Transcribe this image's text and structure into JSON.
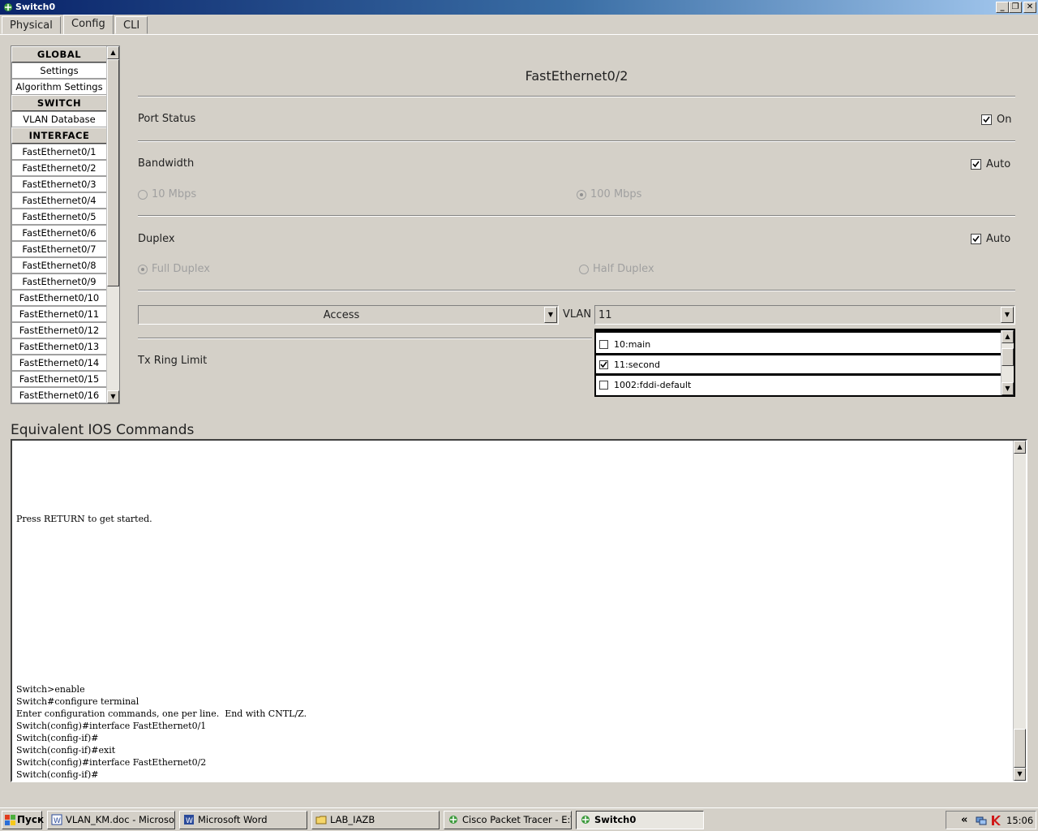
{
  "window": {
    "title": "Switch0"
  },
  "tabs": [
    {
      "label": "Physical"
    },
    {
      "label": "Config"
    },
    {
      "label": "CLI"
    }
  ],
  "sidebar": {
    "items": [
      {
        "label": "GLOBAL"
      },
      {
        "label": "Settings"
      },
      {
        "label": "Algorithm Settings"
      },
      {
        "label": "SWITCH"
      },
      {
        "label": "VLAN Database"
      },
      {
        "label": "INTERFACE"
      },
      {
        "label": "FastEthernet0/1"
      },
      {
        "label": "FastEthernet0/2"
      },
      {
        "label": "FastEthernet0/3"
      },
      {
        "label": "FastEthernet0/4"
      },
      {
        "label": "FastEthernet0/5"
      },
      {
        "label": "FastEthernet0/6"
      },
      {
        "label": "FastEthernet0/7"
      },
      {
        "label": "FastEthernet0/8"
      },
      {
        "label": "FastEthernet0/9"
      },
      {
        "label": "FastEthernet0/10"
      },
      {
        "label": "FastEthernet0/11"
      },
      {
        "label": "FastEthernet0/12"
      },
      {
        "label": "FastEthernet0/13"
      },
      {
        "label": "FastEthernet0/14"
      },
      {
        "label": "FastEthernet0/15"
      },
      {
        "label": "FastEthernet0/16"
      }
    ]
  },
  "config": {
    "interface_title": "FastEthernet0/2",
    "port_status": {
      "label": "Port Status",
      "check_label": "On",
      "checked": true
    },
    "bandwidth": {
      "label": "Bandwidth",
      "check_label": "Auto",
      "checked": true,
      "opt1": "10 Mbps",
      "opt2": "100 Mbps"
    },
    "duplex": {
      "label": "Duplex",
      "check_label": "Auto",
      "checked": true,
      "opt1": "Full Duplex",
      "opt2": "Half Duplex"
    },
    "mode": {
      "value": "Access"
    },
    "vlan": {
      "label": "VLAN",
      "value": "11",
      "options": [
        {
          "label": "10:main",
          "checked": false
        },
        {
          "label": "11:second",
          "checked": true
        },
        {
          "label": "1002:fddi-default",
          "checked": false
        }
      ]
    },
    "tx_ring": {
      "label": "Tx Ring Limit"
    }
  },
  "ios": {
    "title": "Equivalent IOS Commands",
    "press_return": "Press RETURN to get started.",
    "lines": [
      "Switch>enable",
      "Switch#configure terminal",
      "Enter configuration commands, one per line.  End with CNTL/Z.",
      "Switch(config)#interface FastEthernet0/1",
      "Switch(config-if)#",
      "Switch(config-if)#exit",
      "Switch(config)#interface FastEthernet0/2",
      "Switch(config-if)#"
    ]
  },
  "taskbar": {
    "start": "Пуск",
    "tasks": [
      {
        "label": "VLAN_KM.doc - Microsof..."
      },
      {
        "label": "Microsoft Word"
      },
      {
        "label": "LAB_IAZB"
      },
      {
        "label": "Cisco Packet Tracer - E:\\..."
      },
      {
        "label": "Switch0"
      }
    ],
    "clock": "15:06",
    "tray_chevron": "«"
  },
  "colors": {
    "titlebar_start": "#0a246a",
    "titlebar_end": "#a6caf0",
    "face": "#d4d0c8"
  }
}
